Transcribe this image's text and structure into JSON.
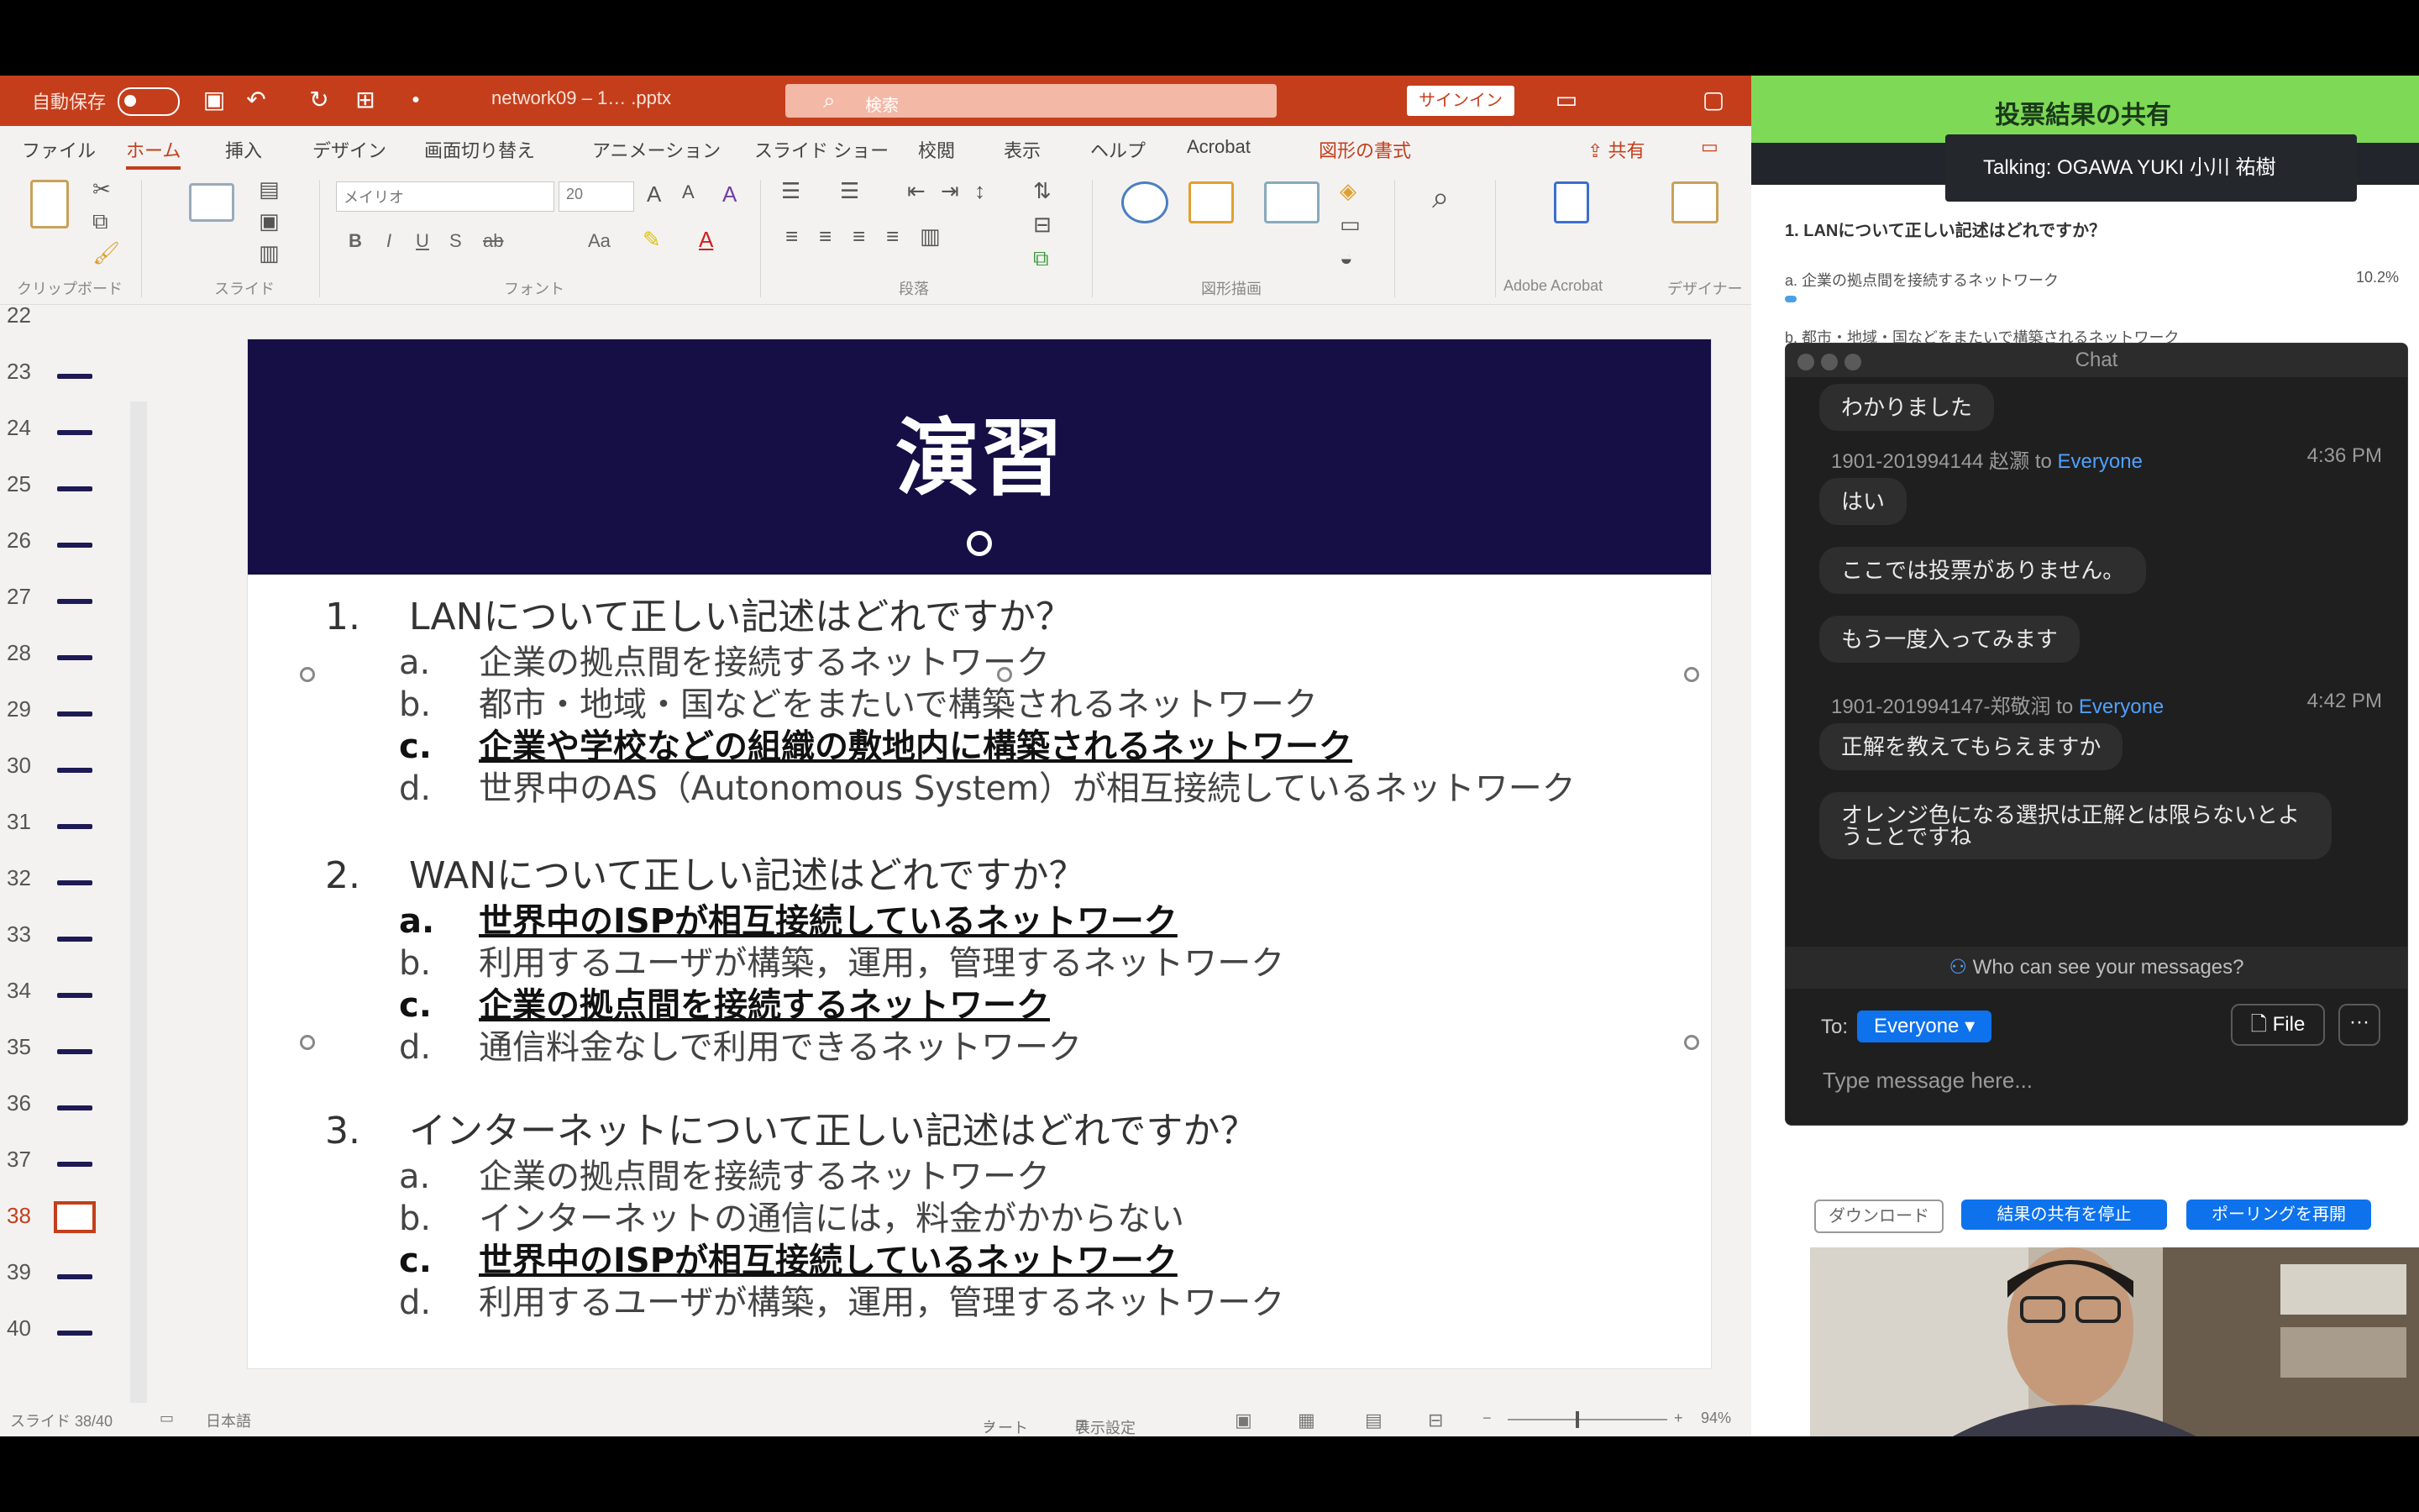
{
  "powerpoint": {
    "autosave_label": "自動保存",
    "filename": "network09 – 1… .pptx",
    "search_placeholder": "検索",
    "signin_label": "サインイン",
    "ribbon_tabs": [
      "ファイル",
      "ホーム",
      "挿入",
      "デザイン",
      "画面切り替え",
      "アニメーション",
      "スライド ショー",
      "校閲",
      "表示",
      "ヘルプ",
      "Acrobat",
      "図形の書式"
    ],
    "share_label": "共有",
    "ribbon_groups": [
      "クリップボード",
      "スライド",
      "フォント",
      "段落",
      "図形描画",
      "Adobe Acrobat",
      "デザイナー"
    ],
    "font_name": "メイリオ",
    "font_size": "20",
    "thumb_numbers": [
      "22",
      "23",
      "24",
      "25",
      "26",
      "27",
      "28",
      "29",
      "30",
      "31",
      "32",
      "33",
      "34",
      "35",
      "36",
      "37",
      "38",
      "39",
      "40"
    ],
    "selected_slide": "38",
    "status": {
      "slide_counter": "スライド 38/40",
      "language": "日本語",
      "notes": "ノート",
      "display_settings": "表示設定",
      "zoom": "94%"
    }
  },
  "slide": {
    "title": "演習",
    "questions": [
      {
        "num": "1.",
        "text": "LANについて正しい記述はどれですか？",
        "options": [
          {
            "letter": "a.",
            "text": "企業の拠点間を接続するネットワーク",
            "bold": false
          },
          {
            "letter": "b.",
            "text": "都市・地域・国などをまたいで構築されるネットワーク",
            "bold": false
          },
          {
            "letter": "c.",
            "text": "企業や学校などの組織の敷地内に構築されるネットワーク",
            "bold": true
          },
          {
            "letter": "d.",
            "text": "世界中のAS（Autonomous System）が相互接続しているネットワーク",
            "bold": false
          }
        ]
      },
      {
        "num": "2.",
        "text": "WANについて正しい記述はどれですか？",
        "options": [
          {
            "letter": "a.",
            "text": "世界中のISPが相互接続しているネットワーク",
            "bold": true
          },
          {
            "letter": "b.",
            "text": "利用するユーザが構築，運用，管理するネットワーク",
            "bold": false
          },
          {
            "letter": "c.",
            "text": "企業の拠点間を接続するネットワーク",
            "bold": true
          },
          {
            "letter": "d.",
            "text": "通信料金なしで利用できるネットワーク",
            "bold": false
          }
        ]
      },
      {
        "num": "3.",
        "text": "インターネットについて正しい記述はどれですか？",
        "options": [
          {
            "letter": "a.",
            "text": "企業の拠点間を接続するネットワーク",
            "bold": false
          },
          {
            "letter": "b.",
            "text": "インターネットの通信には，料金がかからない",
            "bold": false
          },
          {
            "letter": "c.",
            "text": "世界中のISPが相互接続しているネットワーク",
            "bold": true
          },
          {
            "letter": "d.",
            "text": "利用するユーザが構築，運用，管理するネットワーク",
            "bold": false
          }
        ]
      }
    ]
  },
  "poll_results": {
    "title": "投票結果の共有",
    "question_1": "1. LANについて正しい記述はどれですか？",
    "option_a": "a. 企業の拠点間を接続するネットワーク",
    "option_a_pct": "10.2%",
    "option_b": "b. 都市・地域・国などをまたいで構築されるネットワーク",
    "download_label": "ダウンロード",
    "stop_share_label": "結果の共有を停止",
    "rerun_label": "ポーリングを再開"
  },
  "talking_indicator": "Talking: OGAWA YUKI 小川 祐樹",
  "chat": {
    "title": "Chat",
    "messages": [
      {
        "type": "bubble",
        "text": "わかりました"
      },
      {
        "type": "header",
        "sender": "1901-201994144 赵灏",
        "to": "to",
        "recipient": "Everyone",
        "time": "4:36 PM"
      },
      {
        "type": "bubble",
        "text": "はい"
      },
      {
        "type": "bubble",
        "text": "ここでは投票がありません。"
      },
      {
        "type": "bubble",
        "text": "もう一度入ってみます"
      },
      {
        "type": "header",
        "sender": "1901-201994147-郑敬润",
        "to": "to",
        "recipient": "Everyone",
        "time": "4:42 PM"
      },
      {
        "type": "bubble",
        "text": "正解を教えてもらえますか"
      },
      {
        "type": "bubble",
        "text": "オレンジ色になる選択は正解とは限らないとよ\nうことですね"
      }
    ],
    "who_can_see": "Who can see your messages?",
    "to_label": "To:",
    "to_value": "Everyone",
    "file_button": "File",
    "more_button": "···",
    "input_placeholder": "Type message here..."
  },
  "colors": {
    "ppt_red": "#c43e1c",
    "slide_header": "#150f45",
    "zoom_blue": "#0e72ed",
    "poll_green": "#7ed957"
  }
}
